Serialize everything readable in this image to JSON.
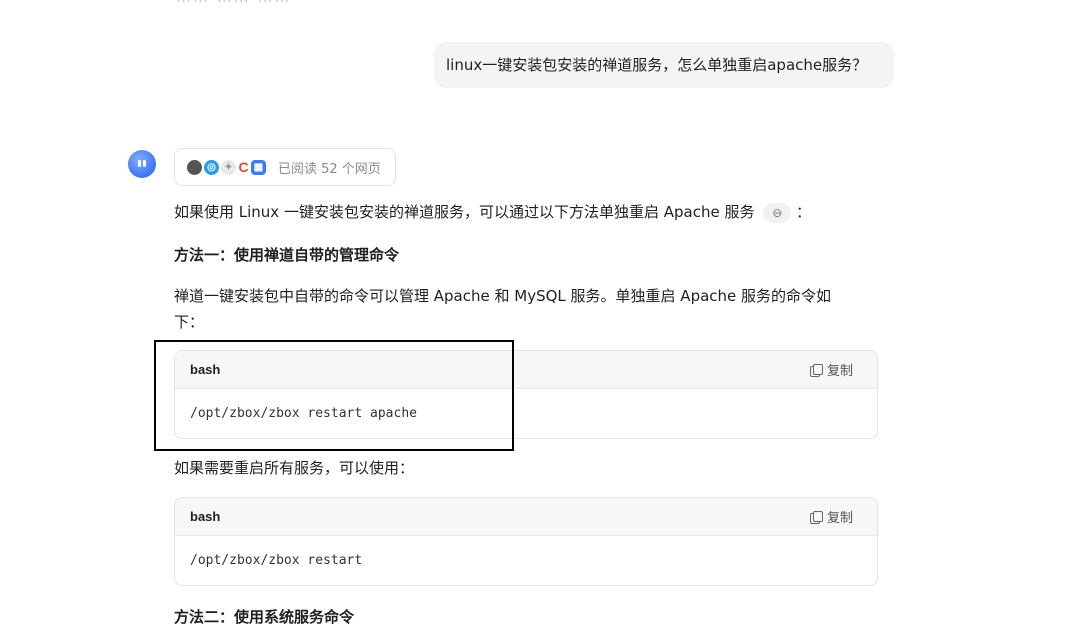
{
  "top_partial_text": "……  ……  ……",
  "user_message": "linux一键安装包安装的禅道服务，怎么单独重启apache服务？",
  "sources": {
    "icons": [
      "avatar-source-icon",
      "weibo-icon",
      "blank-source-icon",
      "c-source-icon",
      "grid-source-icon"
    ],
    "c_letter": "C",
    "label": "已阅读 52 个网页"
  },
  "response": {
    "intro": "如果使用 Linux 一键安装包安装的禅道服务，可以通过以下方法单独重启 Apache 服务",
    "intro_suffix": "：",
    "method1_heading": "方法一：使用禅道自带的管理命令",
    "method1_desc_line1": "禅道一键安装包中自带的命令可以管理 Apache 和 MySQL 服务。单独重启 Apache 服务的命令如",
    "method1_desc_line2": "下：",
    "code1": {
      "lang": "bash",
      "copy_label": "复制",
      "code": "/opt/zbox/zbox restart apache"
    },
    "restart_all_text": "如果需要重启所有服务，可以使用：",
    "code2": {
      "lang": "bash",
      "copy_label": "复制",
      "code": "/opt/zbox/zbox restart"
    },
    "method2_heading": "方法二：使用系统服务命令"
  },
  "colors": {
    "avatar": "#3f73f0",
    "bubble_bg": "#f4f4f5",
    "highlight_border": "#000000"
  }
}
